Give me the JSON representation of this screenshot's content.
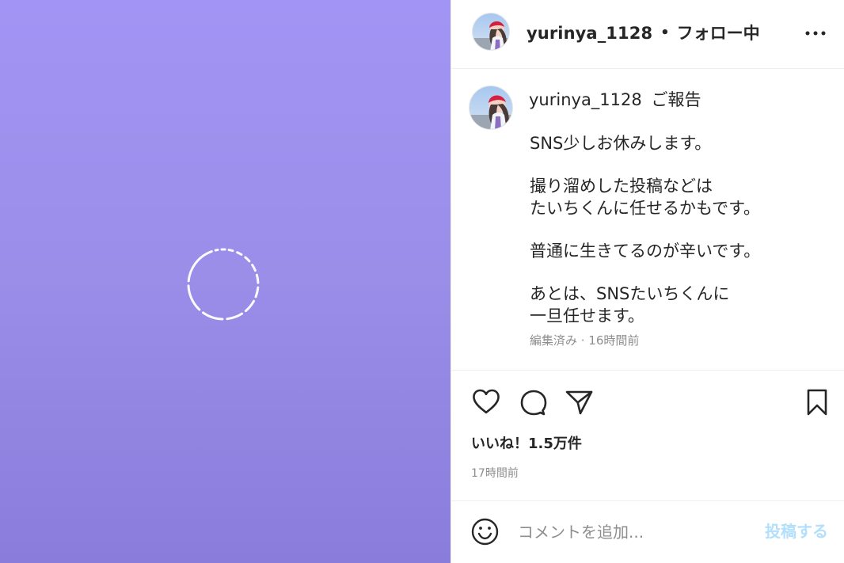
{
  "header": {
    "username": "yurinya_1128",
    "separator": "•",
    "follow_state": "フォロー中"
  },
  "caption": {
    "username": "yurinya_1128",
    "title": "ご報告",
    "lines": [
      "SNS少しお休みします。",
      "",
      "撮り溜めした投稿などは",
      "たいちくんに任せるかもです。",
      "",
      "普通に生きてるのが辛いです。",
      "",
      "あとは、SNSたいちくんに",
      "一旦任せます。"
    ],
    "meta": "編集済み · 16時間前"
  },
  "actions": {
    "likes": "いいね！1.5万件",
    "time": "17時間前"
  },
  "comment": {
    "placeholder": "コメントを追加...",
    "post_label": "投稿する"
  },
  "colors": {
    "media_top": "#a294f4",
    "media_bottom": "#8a7cdb",
    "text_primary": "#262626",
    "text_secondary": "#8e8e8e",
    "post_button": "#b2dffc"
  },
  "icons": {
    "media_loading": "loading-spinner-icon",
    "more": "more-horizontal-icon",
    "like": "heart-icon",
    "comment": "comment-icon",
    "share": "paper-plane-icon",
    "save": "bookmark-icon",
    "emoji": "emoji-icon"
  }
}
